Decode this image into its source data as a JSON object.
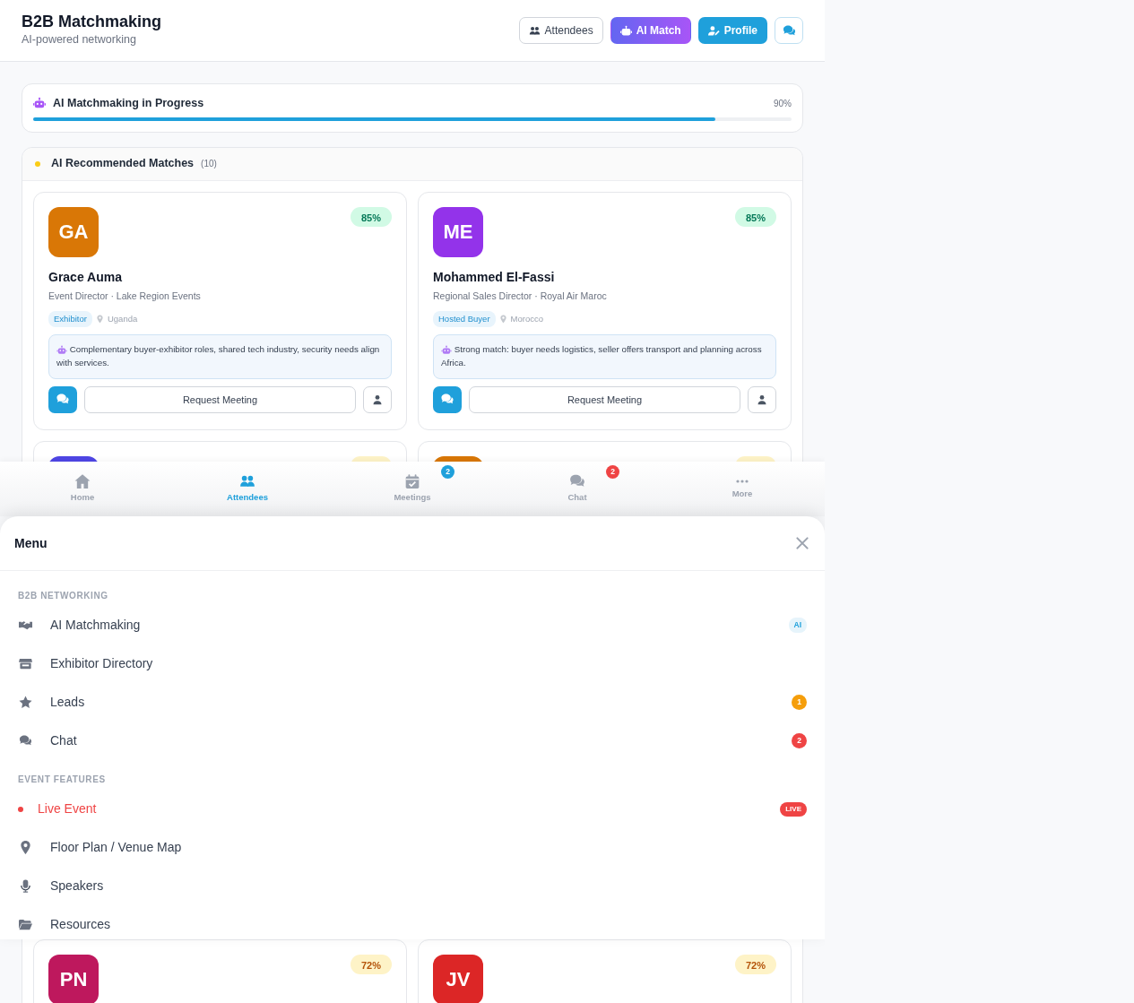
{
  "header": {
    "title": "B2B Matchmaking",
    "subtitle": "AI-powered networking",
    "buttons": [
      {
        "label": "Attendees",
        "kind": "outline"
      },
      {
        "label": "AI Match",
        "kind": "ai"
      },
      {
        "label": "Profile",
        "kind": "primary"
      },
      {
        "kind": "chat"
      }
    ]
  },
  "progress": {
    "title": "AI Matchmaking in Progress",
    "reading": "90%",
    "level": 0.9
  },
  "matches": {
    "title": "AI Recommended Matches",
    "count": "(10)",
    "cards": [
      {
        "initials": "GA",
        "color": "#d97706",
        "score": "85%",
        "kind": "high",
        "name": "Grace Auma",
        "role": "Event Director · Lake Region Events",
        "tag": "Exhibitor",
        "location": "Uganda",
        "reason": "Complementary buyer-exhibitor roles, shared tech industry, security needs align with services.",
        "action": "Request Meeting"
      },
      {
        "initials": "ME",
        "color": "#9333ea",
        "score": "85%",
        "kind": "high",
        "name": "Mohammed El-Fassi",
        "role": "Regional Sales Director · Royal Air Maroc",
        "tag": "Hosted Buyer",
        "location": "Morocco",
        "reason": "Strong match: buyer needs logistics, seller offers transport and planning across Africa.",
        "action": "Request Meeting"
      },
      {
        "color": "#4f46e5",
        "kind": "mid"
      },
      {
        "color": "#d97706",
        "kind": "mid"
      },
      {
        "initials": "PN",
        "color": "#be185d",
        "score": "72%",
        "kind": "mid"
      },
      {
        "initials": "JV",
        "color": "#dc2626",
        "score": "72%",
        "kind": "mid"
      }
    ]
  },
  "bottom_nav": [
    {
      "label": "Home",
      "selected": false
    },
    {
      "label": "Attendees",
      "selected": true
    },
    {
      "label": "Meetings",
      "selected": false,
      "badge": "2",
      "color": "#1fa0db"
    },
    {
      "label": "Chat",
      "selected": false,
      "badge": "2",
      "color": "#ef4444"
    },
    {
      "label": "More",
      "selected": false
    }
  ],
  "menu": {
    "title": "Menu",
    "sections": [
      {
        "title": "B2B NETWORKING",
        "items": [
          {
            "label": "AI Matchmaking",
            "badge": "AI",
            "kind": "ai"
          },
          {
            "label": "Exhibitor Directory",
            "kind": "plain"
          },
          {
            "label": "Leads",
            "badge": "1",
            "kind": "count",
            "color": "#f59e0b"
          },
          {
            "label": "Chat",
            "badge": "2",
            "kind": "count",
            "color": "#ef4444"
          }
        ]
      },
      {
        "title": "EVENT FEATURES",
        "items": [
          {
            "label": "Live Event",
            "kind": "live",
            "badge": "LIVE"
          },
          {
            "label": "Floor Plan / Venue Map",
            "kind": "plain"
          },
          {
            "label": "Speakers",
            "kind": "plain"
          },
          {
            "label": "Resources",
            "kind": "plain"
          }
        ]
      }
    ]
  }
}
